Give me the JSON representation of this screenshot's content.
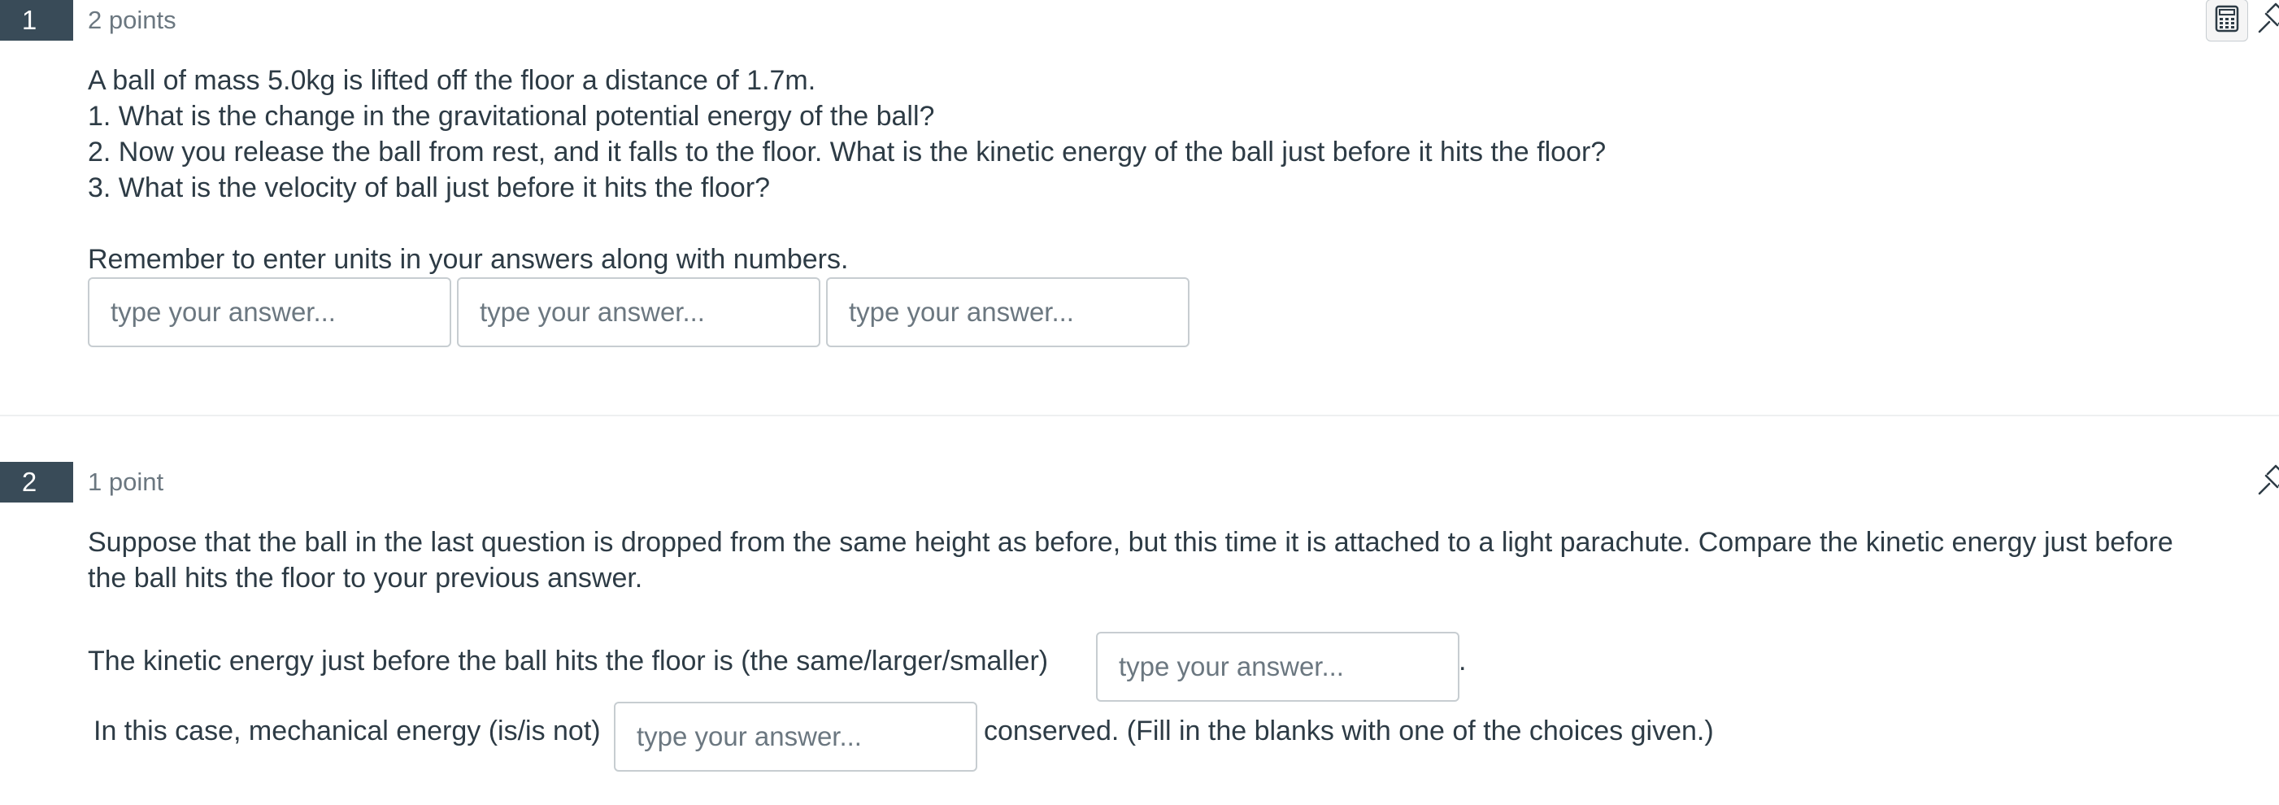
{
  "questions": [
    {
      "number": "1",
      "points": "2 points",
      "lines": [
        "A ball of mass 5.0kg is lifted off the floor a distance of 1.7m.",
        "1. What is the change in the gravitational potential energy of the ball?",
        "2. Now you release the ball from rest, and it falls to the floor. What is the kinetic energy of the ball just before it hits the floor?",
        "3. What is the velocity of ball just before it hits the floor?"
      ],
      "reminder": "Remember to enter units in your answers along with numbers.",
      "inputs": [
        {
          "placeholder": "type your answer...",
          "value": ""
        },
        {
          "placeholder": "type your answer...",
          "value": ""
        },
        {
          "placeholder": "type your answer...",
          "value": ""
        }
      ]
    },
    {
      "number": "2",
      "points": "1 point",
      "lines": [
        "Suppose that the ball in the last question is dropped from the same height as before, but this time it is attached to a light parachute. Compare the kinetic energy just before",
        "the ball hits the floor to your previous answer."
      ],
      "blank1_prefix": "The kinetic energy just before the ball hits the floor is (the same/larger/smaller)",
      "blank1_suffix": ".",
      "blank2_prefix": "In this case, mechanical energy (is/is not)",
      "blank2_suffix": "conserved. (Fill in the blanks with one of the choices given.)",
      "inputs": [
        {
          "placeholder": "type your answer...",
          "value": ""
        },
        {
          "placeholder": "type your answer...",
          "value": ""
        }
      ]
    }
  ],
  "icons": {
    "calculator": "calculator-icon",
    "pin": "pin-icon"
  },
  "colors": {
    "badge_bg": "#394b58",
    "text": "#2d3b45",
    "muted": "#6b7780",
    "border": "#c7cdd1"
  }
}
